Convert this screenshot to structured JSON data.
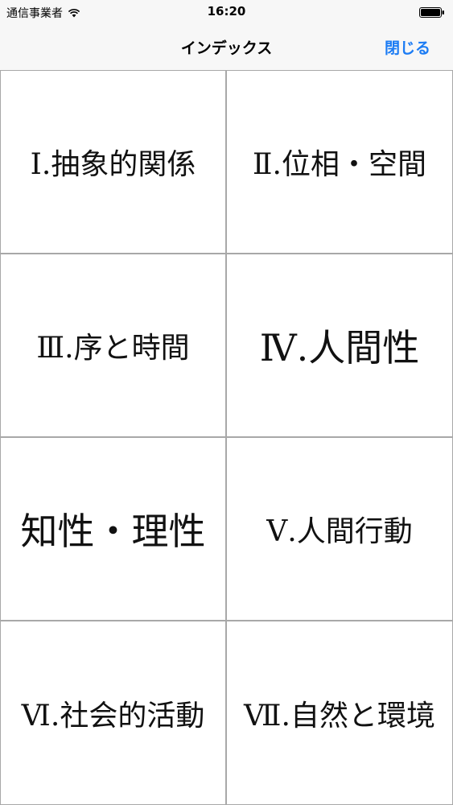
{
  "status_bar": {
    "carrier": "通信事業者",
    "time": "16:20"
  },
  "nav": {
    "title": "インデックス",
    "close_label": "閉じる"
  },
  "index_items": [
    {
      "label": "Ⅰ.抽象的関係"
    },
    {
      "label": "Ⅱ.位相・空間"
    },
    {
      "label": "Ⅲ.序と時間"
    },
    {
      "label": "Ⅳ.人間性"
    },
    {
      "label": "知性・理性"
    },
    {
      "label": "Ⅴ.人間行動"
    },
    {
      "label": "Ⅵ.社会的活動"
    },
    {
      "label": "Ⅶ.自然と環境"
    }
  ]
}
